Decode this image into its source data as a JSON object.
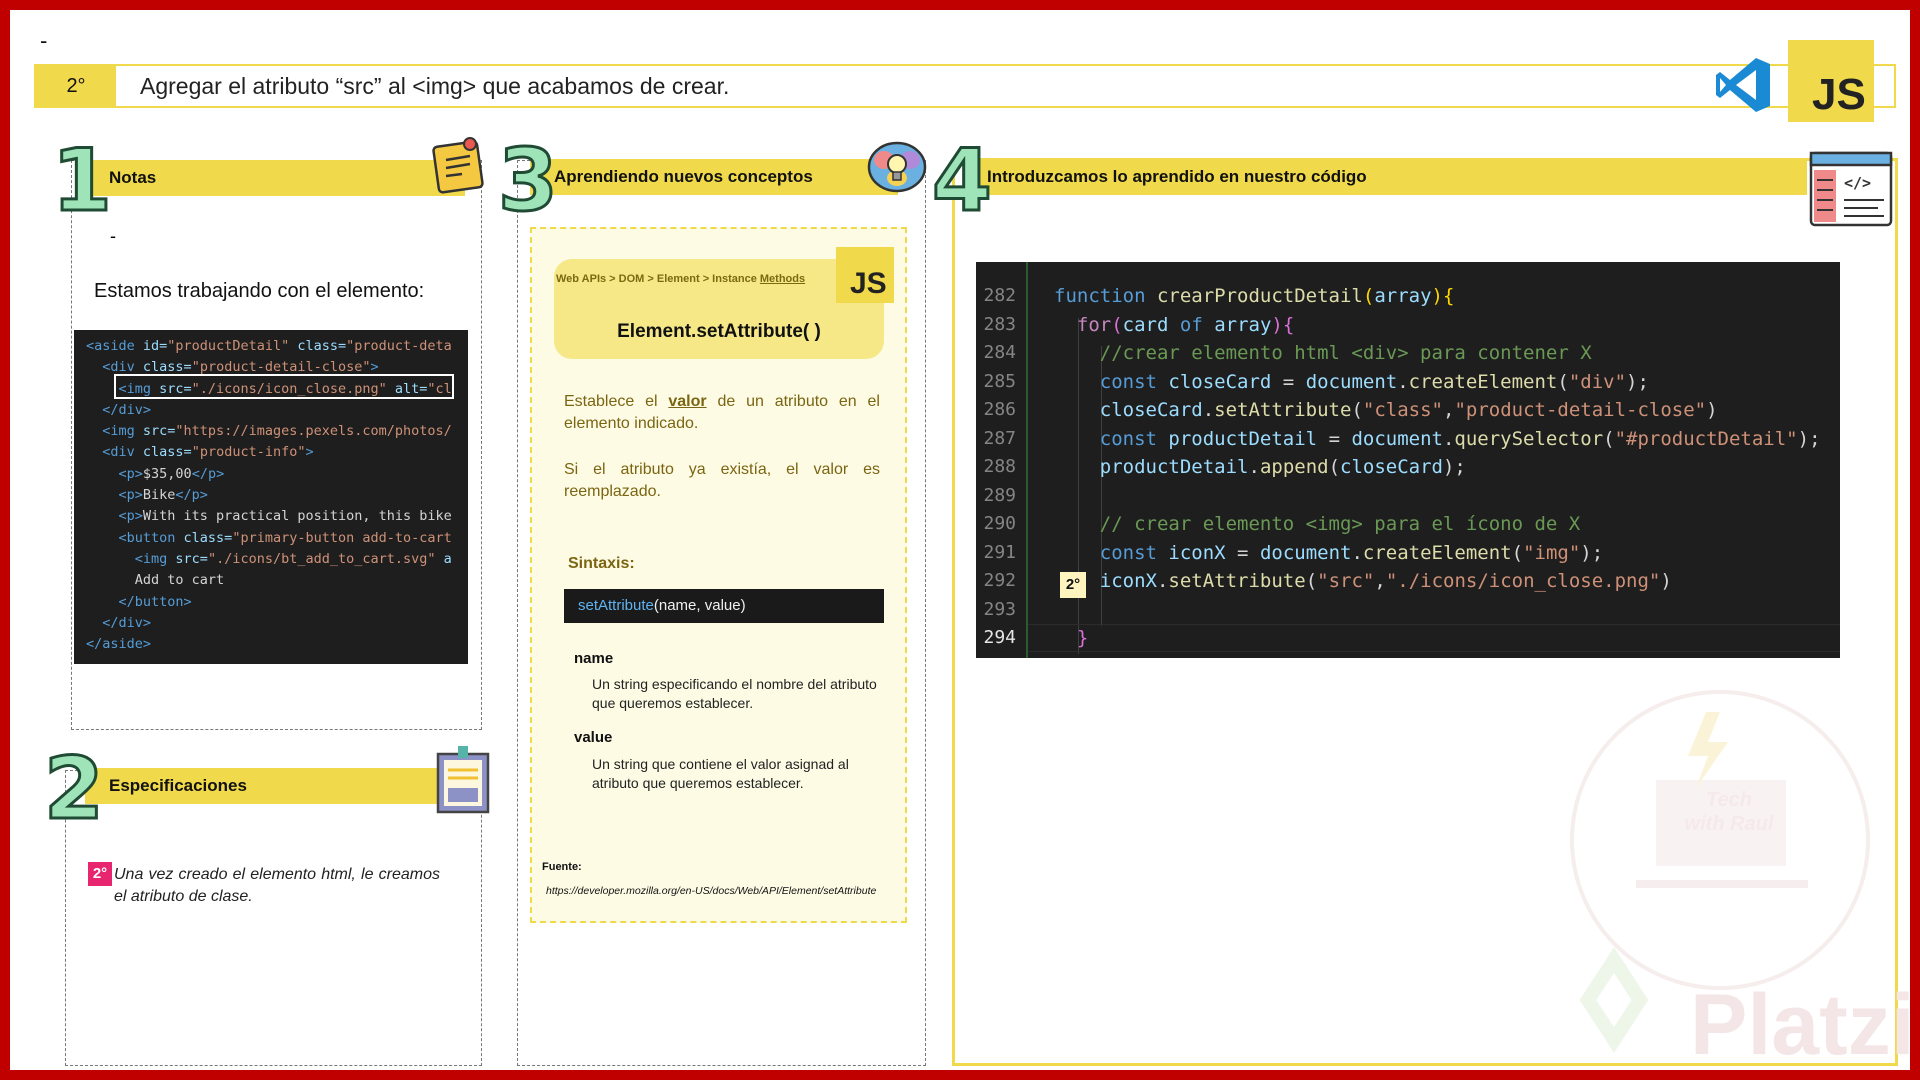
{
  "header": {
    "dash": "-",
    "step_number": "2°",
    "step_title": "Agregar el atributo “src” al <img> que acabamos de crear.",
    "js_badge": "JS"
  },
  "section1": {
    "number": "1",
    "title": "Notas",
    "dash": "-",
    "text": "Estamos trabajando con el elemento:",
    "code_lines": [
      [
        {
          "t": "tag",
          "v": "<aside "
        },
        {
          "t": "attr",
          "v": "id="
        },
        {
          "t": "str",
          "v": "\"productDetail\" "
        },
        {
          "t": "attr",
          "v": "class="
        },
        {
          "t": "str",
          "v": "\"product-deta"
        }
      ],
      [
        {
          "t": "txt",
          "v": "  "
        },
        {
          "t": "tag",
          "v": "<div "
        },
        {
          "t": "attr",
          "v": "class="
        },
        {
          "t": "str",
          "v": "\"product-detail-close\""
        },
        {
          "t": "tag",
          "v": ">"
        }
      ],
      [
        {
          "t": "txt",
          "v": "    "
        },
        {
          "t": "tag",
          "v": "<img "
        },
        {
          "t": "attr",
          "v": "src="
        },
        {
          "t": "str",
          "v": "\"./icons/icon_close.png\" "
        },
        {
          "t": "attr",
          "v": "alt="
        },
        {
          "t": "str",
          "v": "\"cl"
        }
      ],
      [
        {
          "t": "txt",
          "v": "  "
        },
        {
          "t": "tag",
          "v": "</div>"
        }
      ],
      [
        {
          "t": "txt",
          "v": "  "
        },
        {
          "t": "tag",
          "v": "<img "
        },
        {
          "t": "attr",
          "v": "src="
        },
        {
          "t": "str",
          "v": "\"https://images.pexels.com/photos/"
        }
      ],
      [
        {
          "t": "txt",
          "v": "  "
        },
        {
          "t": "tag",
          "v": "<div "
        },
        {
          "t": "attr",
          "v": "class="
        },
        {
          "t": "str",
          "v": "\"product-info\""
        },
        {
          "t": "tag",
          "v": ">"
        }
      ],
      [
        {
          "t": "txt",
          "v": "    "
        },
        {
          "t": "tag",
          "v": "<p>"
        },
        {
          "t": "txt",
          "v": "$35,00"
        },
        {
          "t": "tag",
          "v": "</p>"
        }
      ],
      [
        {
          "t": "txt",
          "v": "    "
        },
        {
          "t": "tag",
          "v": "<p>"
        },
        {
          "t": "txt",
          "v": "Bike"
        },
        {
          "t": "tag",
          "v": "</p>"
        }
      ],
      [
        {
          "t": "txt",
          "v": "    "
        },
        {
          "t": "tag",
          "v": "<p>"
        },
        {
          "t": "txt",
          "v": "With its practical position, this bike"
        }
      ],
      [
        {
          "t": "txt",
          "v": "    "
        },
        {
          "t": "tag",
          "v": "<button "
        },
        {
          "t": "attr",
          "v": "class="
        },
        {
          "t": "str",
          "v": "\"primary-button add-to-cart"
        }
      ],
      [
        {
          "t": "txt",
          "v": "      "
        },
        {
          "t": "tag",
          "v": "<img "
        },
        {
          "t": "attr",
          "v": "src="
        },
        {
          "t": "str",
          "v": "\"./icons/bt_add_to_cart.svg\" "
        },
        {
          "t": "attr",
          "v": "a"
        }
      ],
      [
        {
          "t": "txt",
          "v": "      Add to cart"
        }
      ],
      [
        {
          "t": "txt",
          "v": "    "
        },
        {
          "t": "tag",
          "v": "</button>"
        }
      ],
      [
        {
          "t": "txt",
          "v": "  "
        },
        {
          "t": "tag",
          "v": "</div>"
        }
      ],
      [
        {
          "t": "tag",
          "v": "</aside>"
        }
      ]
    ]
  },
  "section2": {
    "number": "2",
    "title": "Especificaciones",
    "badge": "2°",
    "text": "Una vez creado el elemento html, le creamos el atributo de clase."
  },
  "section3": {
    "number": "3",
    "title": "Aprendiendo nuevos conceptos",
    "breadcrumb": "Web APIs > DOM > Element > Instance",
    "breadcrumb_link": "Methods",
    "js_badge": "JS",
    "method": "Element.setAttribute( )",
    "desc1_pre": "Establece el",
    "desc1_bold": "valor",
    "desc1_post": "de un atributo en el elemento indicado.",
    "desc2": "Si el atributo ya existía, el valor es reemplazado.",
    "syntax_title": "Sintaxis:",
    "syntax_fn": "setAttribute",
    "syntax_args": "(name, value)",
    "param1_name": "name",
    "param1_desc": "Un string especificando el nombre del atributo que queremos establecer.",
    "param2_name": "value",
    "param2_desc": "Un string que contiene el valor asignad al atributo que queremos establecer.",
    "source_label": "Fuente:",
    "source_url": "https://developer.mozilla.org/en-US/docs/Web/API/Element/setAttribute"
  },
  "section4": {
    "number": "4",
    "title": "Introduzcamos lo aprendido en nuestro código",
    "badge": "2°",
    "line_numbers": [
      "282",
      "283",
      "284",
      "285",
      "286",
      "287",
      "288",
      "289",
      "290",
      "291",
      "292",
      "293",
      "294"
    ],
    "code_lines": [
      [
        {
          "t": "k",
          "v": "function "
        },
        {
          "t": "f",
          "v": "crearProductDetail"
        },
        {
          "t": "br",
          "v": "("
        },
        {
          "t": "v",
          "v": "array"
        },
        {
          "t": "br",
          "v": ")"
        },
        {
          "t": "br",
          "v": "{"
        }
      ],
      [
        {
          "t": "txt",
          "v": "  "
        },
        {
          "t": "k2",
          "v": "for"
        },
        {
          "t": "br2",
          "v": "("
        },
        {
          "t": "v",
          "v": "card "
        },
        {
          "t": "k",
          "v": "of "
        },
        {
          "t": "v",
          "v": "array"
        },
        {
          "t": "br2",
          "v": ")"
        },
        {
          "t": "br2",
          "v": "{"
        }
      ],
      [
        {
          "t": "txt",
          "v": "    "
        },
        {
          "t": "c",
          "v": "//crear elemento html <div> para contener X"
        }
      ],
      [
        {
          "t": "txt",
          "v": "    "
        },
        {
          "t": "k",
          "v": "const "
        },
        {
          "t": "v",
          "v": "closeCard "
        },
        {
          "t": "txt",
          "v": "= "
        },
        {
          "t": "v",
          "v": "document"
        },
        {
          "t": "txt",
          "v": "."
        },
        {
          "t": "f",
          "v": "createElement"
        },
        {
          "t": "txt",
          "v": "("
        },
        {
          "t": "s",
          "v": "\"div\""
        },
        {
          "t": "txt",
          "v": ");"
        }
      ],
      [
        {
          "t": "txt",
          "v": "    "
        },
        {
          "t": "v",
          "v": "closeCard"
        },
        {
          "t": "txt",
          "v": "."
        },
        {
          "t": "f",
          "v": "setAttribute"
        },
        {
          "t": "txt",
          "v": "("
        },
        {
          "t": "s",
          "v": "\"class\""
        },
        {
          "t": "txt",
          "v": ","
        },
        {
          "t": "s",
          "v": "\"product-detail-close\""
        },
        {
          "t": "txt",
          "v": ")"
        }
      ],
      [
        {
          "t": "txt",
          "v": "    "
        },
        {
          "t": "k",
          "v": "const "
        },
        {
          "t": "v",
          "v": "productDetail "
        },
        {
          "t": "txt",
          "v": "= "
        },
        {
          "t": "v",
          "v": "document"
        },
        {
          "t": "txt",
          "v": "."
        },
        {
          "t": "f",
          "v": "querySelector"
        },
        {
          "t": "txt",
          "v": "("
        },
        {
          "t": "s",
          "v": "\"#productDetail\""
        },
        {
          "t": "txt",
          "v": ");"
        }
      ],
      [
        {
          "t": "txt",
          "v": "    "
        },
        {
          "t": "v",
          "v": "productDetail"
        },
        {
          "t": "txt",
          "v": "."
        },
        {
          "t": "f",
          "v": "append"
        },
        {
          "t": "txt",
          "v": "("
        },
        {
          "t": "v",
          "v": "closeCard"
        },
        {
          "t": "txt",
          "v": ");"
        }
      ],
      [
        {
          "t": "txt",
          "v": ""
        }
      ],
      [
        {
          "t": "txt",
          "v": "    "
        },
        {
          "t": "c",
          "v": "// crear elemento <img> para el ícono de X"
        }
      ],
      [
        {
          "t": "txt",
          "v": "    "
        },
        {
          "t": "k",
          "v": "const "
        },
        {
          "t": "v",
          "v": "iconX "
        },
        {
          "t": "txt",
          "v": "= "
        },
        {
          "t": "v",
          "v": "document"
        },
        {
          "t": "txt",
          "v": "."
        },
        {
          "t": "f",
          "v": "createElement"
        },
        {
          "t": "txt",
          "v": "("
        },
        {
          "t": "s",
          "v": "\"img\""
        },
        {
          "t": "txt",
          "v": ");"
        }
      ],
      [
        {
          "t": "txt",
          "v": "    "
        },
        {
          "t": "v",
          "v": "iconX"
        },
        {
          "t": "txt",
          "v": "."
        },
        {
          "t": "f",
          "v": "setAttribute"
        },
        {
          "t": "txt",
          "v": "("
        },
        {
          "t": "s",
          "v": "\"src\""
        },
        {
          "t": "txt",
          "v": ","
        },
        {
          "t": "s",
          "v": "\"./icons/icon_close.png\""
        },
        {
          "t": "txt",
          "v": ")"
        }
      ],
      [
        {
          "t": "txt",
          "v": ""
        }
      ],
      [
        {
          "t": "txt",
          "v": "  "
        },
        {
          "t": "br2",
          "v": "}"
        }
      ]
    ]
  },
  "watermark": {
    "brand": "Platzi",
    "logo_text": "Tech with Raul"
  },
  "colors": {
    "frame": "#c00000",
    "accent_yellow": "#f0d94a",
    "number_green": "#9fe3b9",
    "badge_pink": "#e8266f"
  }
}
